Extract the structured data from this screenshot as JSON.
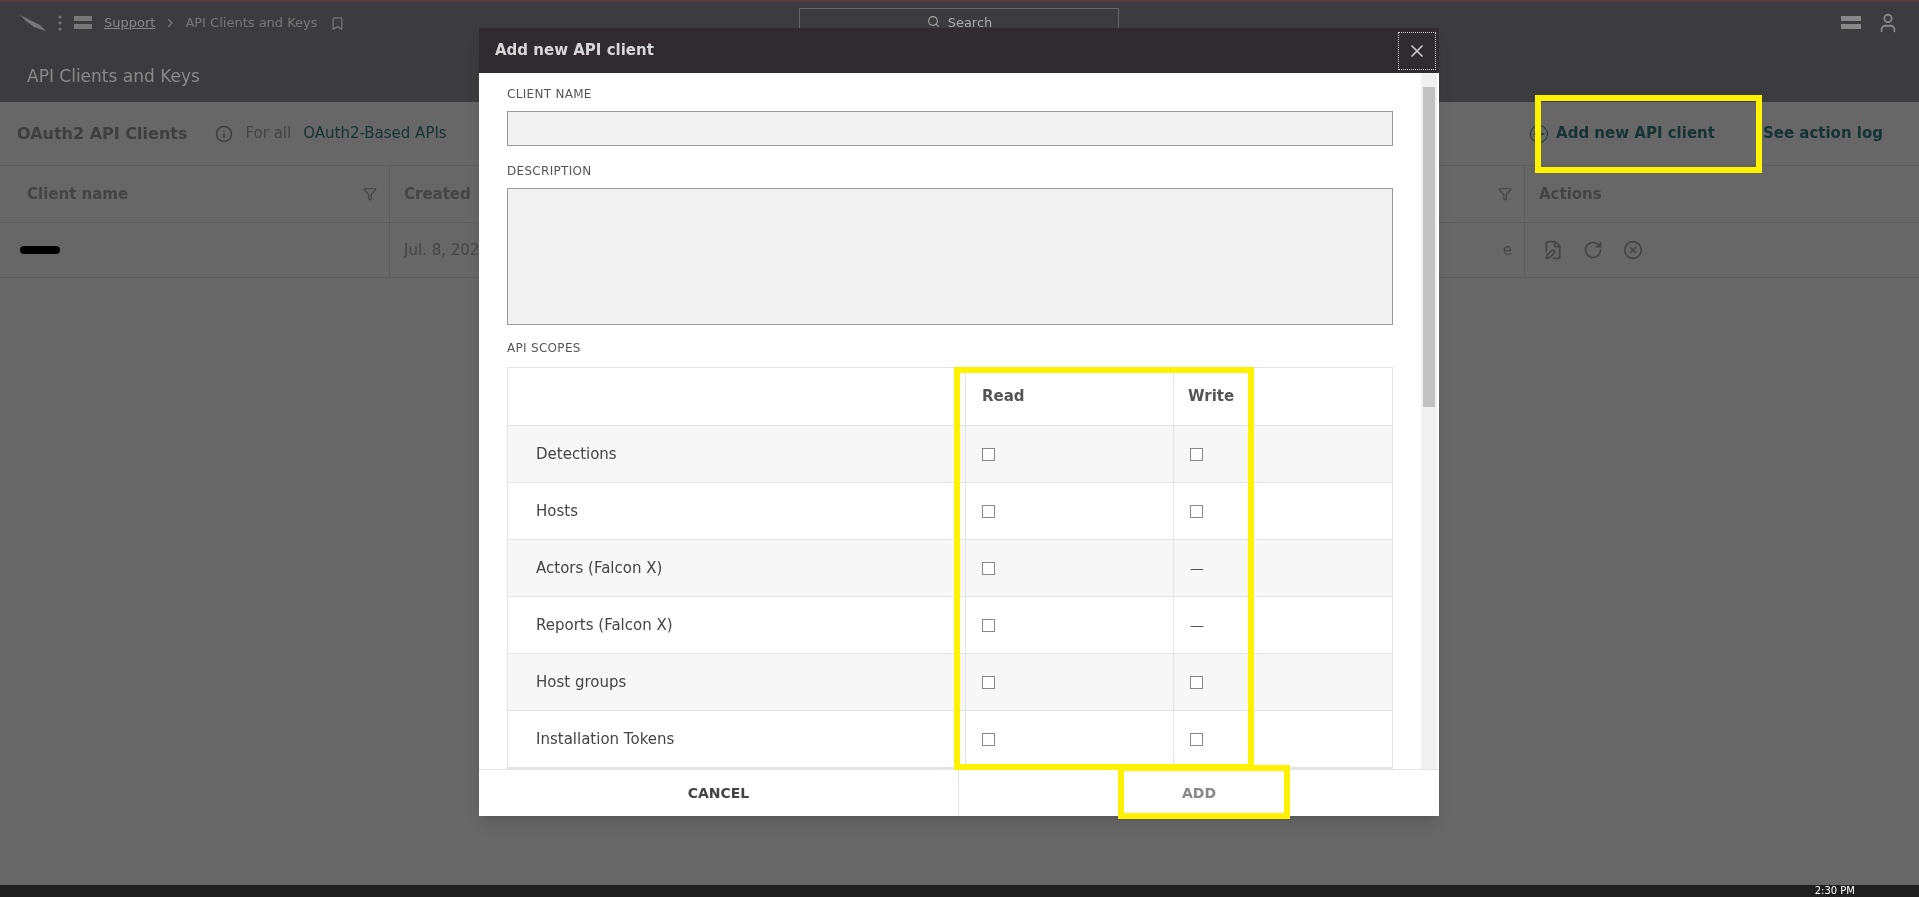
{
  "nav": {
    "breadcrumb": [
      "Support",
      "API Clients and Keys"
    ],
    "search": {
      "placeholder": "Search"
    }
  },
  "page": {
    "title": "API Clients and Keys"
  },
  "section": {
    "title": "OAuth2 API Clients",
    "info_prefix": "For all",
    "info_link": "OAuth2-Based APIs",
    "add_button": "Add new API client",
    "log_link": "See action log"
  },
  "table": {
    "columns": [
      "Client name",
      "Created",
      "Actions"
    ],
    "rows": [
      {
        "created": "Jul. 8, 202",
        "column_3": "e"
      }
    ]
  },
  "dialog": {
    "title": "Add new API client",
    "client_name_label": "CLIENT NAME",
    "description_label": "DESCRIPTION",
    "scopes_label": "API SCOPES",
    "scope_columns": [
      "Read",
      "Write"
    ],
    "scopes": [
      {
        "name": "Detections",
        "read": {
          "kind": "checkbox",
          "checked": false
        },
        "write": {
          "kind": "checkbox",
          "checked": false
        }
      },
      {
        "name": "Hosts",
        "read": {
          "kind": "checkbox",
          "checked": false
        },
        "write": {
          "kind": "checkbox",
          "checked": false
        }
      },
      {
        "name": "Actors (Falcon X)",
        "read": {
          "kind": "checkbox",
          "checked": false
        },
        "write": {
          "kind": "dash",
          "text": "—"
        }
      },
      {
        "name": "Reports (Falcon X)",
        "read": {
          "kind": "checkbox",
          "checked": false
        },
        "write": {
          "kind": "dash",
          "text": "—"
        }
      },
      {
        "name": "Host groups",
        "read": {
          "kind": "checkbox",
          "checked": false
        },
        "write": {
          "kind": "checkbox",
          "checked": false
        }
      },
      {
        "name": "Installation Tokens",
        "read": {
          "kind": "checkbox",
          "checked": false
        },
        "write": {
          "kind": "checkbox",
          "checked": false
        }
      }
    ],
    "buttons": [
      "CANCEL",
      "ADD"
    ]
  },
  "taskbar": {
    "time": "2:30 PM"
  }
}
